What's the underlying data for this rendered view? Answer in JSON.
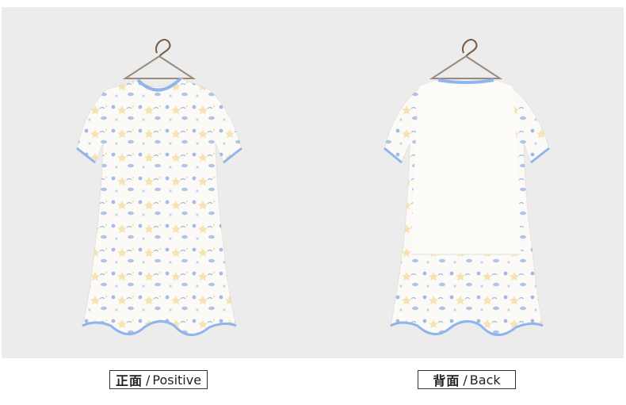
{
  "captions": {
    "front": {
      "cn": "正面",
      "sep": "/",
      "en": "Positive"
    },
    "back": {
      "cn": "背面",
      "sep": "/",
      "en": "Back"
    }
  },
  "colors": {
    "background": "#ececec",
    "garment": "#fbfaf6",
    "trim": "#8fb4ee",
    "print_blue": "#5a86d6",
    "print_yellow": "#f0c96a",
    "hanger": "#7a5a3e"
  },
  "icons": [
    "hanger-icon",
    "pajama-dress-front",
    "pajama-dress-back"
  ]
}
